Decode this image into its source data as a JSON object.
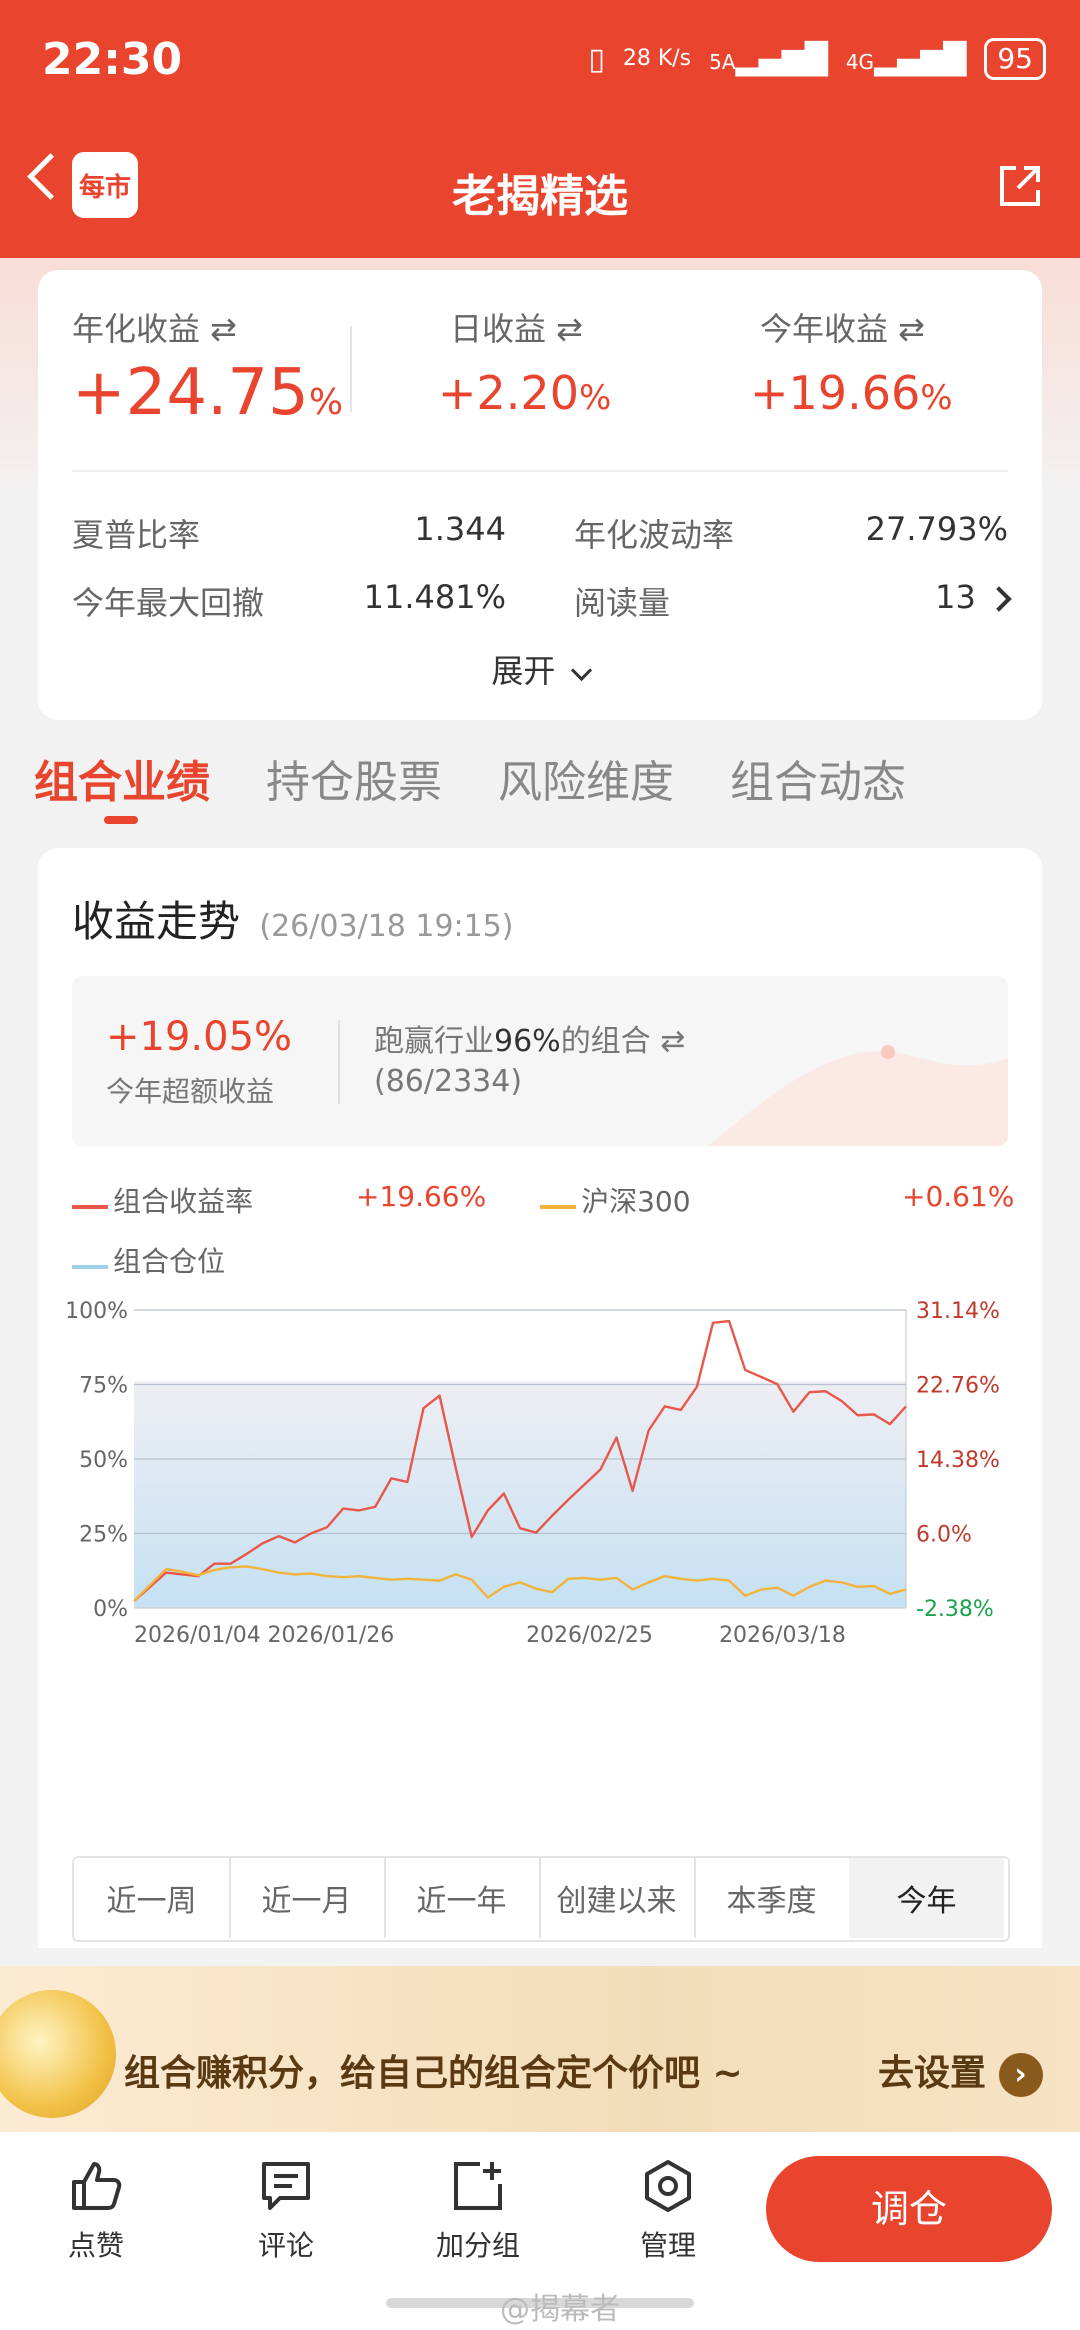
{
  "status": {
    "time": "22:30",
    "net_speed": "28 K/s",
    "sim1": "5A",
    "sim2": "4G",
    "battery": "95"
  },
  "header": {
    "logo_text": "每市",
    "title": "老揭精选"
  },
  "stats": {
    "annual_return": {
      "label": "年化收益 ⇄",
      "value": "+24.75",
      "unit": "%"
    },
    "daily_return": {
      "label": "日收益 ⇄",
      "value": "+2.20",
      "unit": "%"
    },
    "ytd_return": {
      "label": "今年收益 ⇄",
      "value": "+19.66",
      "unit": "%"
    },
    "sharpe": {
      "label": "夏普比率",
      "value": "1.344"
    },
    "volatility": {
      "label": "年化波动率",
      "value": "27.793%"
    },
    "max_drawdown": {
      "label": "今年最大回撤",
      "value": "11.481%"
    },
    "reads": {
      "label": "阅读量",
      "value": "13"
    },
    "expand": "展开"
  },
  "tabs": [
    "组合业绩",
    "持仓股票",
    "风险维度",
    "组合动态"
  ],
  "performance": {
    "title": "收益走势",
    "timestamp": "(26/03/18 19:15)",
    "excess_value": "+19.05%",
    "excess_label": "今年超额收益",
    "beat_text_pre": "跑赢行业",
    "beat_pct": "96%",
    "beat_text_post": "的组合 ⇄",
    "beat_count": "(86/2334)"
  },
  "legend": [
    {
      "name": "组合收益率",
      "value": "+19.66%",
      "color": "#e8574a"
    },
    {
      "name": "沪深300",
      "value": "+0.61%",
      "color": "#f2b33d"
    },
    {
      "name": "组合仓位",
      "value": "",
      "color": "#9fd0ea"
    }
  ],
  "chart_data": {
    "type": "line",
    "left_ticks": [
      "100%",
      "75%",
      "50%",
      "25%",
      "0%"
    ],
    "right_ticks": [
      "31.14%",
      "22.76%",
      "14.38%",
      "6.0%",
      "-2.38%"
    ],
    "x_ticks": [
      "2026/01/04",
      "2026/01/26",
      "2026/02/25",
      "2026/03/18"
    ],
    "ylim_right": [
      -2.38,
      31.14
    ],
    "ylim_left": [
      0,
      100
    ],
    "series": [
      {
        "name": "组合收益率",
        "axis": "right",
        "color": "#e8574a",
        "values": [
          -1.6,
          0.0,
          1.6,
          1.4,
          1.2,
          2.6,
          2.6,
          3.7,
          4.9,
          5.7,
          5.0,
          6.0,
          6.7,
          8.8,
          8.6,
          9.0,
          12.2,
          11.8,
          20.1,
          21.5,
          13.4,
          5.6,
          8.6,
          10.5,
          6.6,
          6.1,
          8.0,
          9.8,
          11.5,
          13.2,
          16.8,
          10.8,
          17.6,
          20.3,
          19.9,
          22.5,
          29.7,
          29.9,
          24.4,
          23.6,
          22.8,
          19.7,
          21.9,
          22.0,
          20.9,
          19.3,
          19.4,
          18.3,
          20.3
        ]
      },
      {
        "name": "沪深300",
        "axis": "right",
        "color": "#f2b33d",
        "values": [
          -1.6,
          0.2,
          2.0,
          1.7,
          1.3,
          1.9,
          2.2,
          2.3,
          2.0,
          1.6,
          1.4,
          1.5,
          1.2,
          1.1,
          1.2,
          1.0,
          0.8,
          0.9,
          0.8,
          0.7,
          1.4,
          0.8,
          -1.2,
          0.0,
          0.5,
          -0.2,
          -0.6,
          0.9,
          1.0,
          0.8,
          1.0,
          -0.3,
          0.5,
          1.2,
          0.9,
          0.7,
          0.9,
          0.7,
          -1.0,
          -0.3,
          -0.1,
          -1.0,
          0.0,
          0.7,
          0.5,
          0.0,
          0.1,
          -0.8,
          -0.3
        ]
      },
      {
        "name": "组合仓位",
        "axis": "left",
        "color": "#9fd0ea",
        "values": [
          76,
          76,
          76,
          76,
          76,
          76,
          76,
          76,
          76,
          76,
          76,
          76,
          76,
          76,
          76,
          76,
          76,
          76,
          76,
          76,
          76,
          76,
          76,
          76,
          76,
          76,
          76,
          76,
          76,
          76,
          76,
          76,
          76,
          76,
          76,
          76,
          76,
          76,
          76,
          76,
          76,
          76,
          76,
          76,
          76,
          76,
          76,
          76,
          76
        ]
      }
    ]
  },
  "ranges": [
    "近一周",
    "近一月",
    "近一年",
    "创建以来",
    "本季度",
    "今年"
  ],
  "selected_range": "今年",
  "banner": {
    "text": "组合赚积分，给自己的组合定个价吧 ~",
    "action": "去设置"
  },
  "bottom_nav": {
    "like": "点赞",
    "comment": "评论",
    "add_group": "加分组",
    "manage": "管理",
    "rebalance": "调仓"
  },
  "watermark": "@揭幕者",
  "colors": {
    "accent": "#e8442e",
    "up": "#e8442e",
    "down": "#1aa34a"
  }
}
